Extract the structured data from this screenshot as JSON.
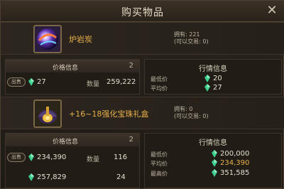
{
  "window": {
    "title": "购买物品",
    "close": "✕"
  },
  "item1": {
    "name": "炉岩炭",
    "owned": "拥有: 221",
    "tradable": "(可以交易: 0)",
    "price_panel": {
      "header": "价格信息",
      "count": "2",
      "sell_label": "出售",
      "price": "27",
      "qty_label": "数量",
      "qty": "259,222"
    },
    "market": {
      "header": "行情信息",
      "min_label": "最低价",
      "min": "20",
      "avg_label": "平均价",
      "avg": "27"
    }
  },
  "item2": {
    "name": "+16~18强化宝珠礼盒",
    "owned": "拥有: 0",
    "tradable": "(可以交易: 0)",
    "price_panel": {
      "header": "价格信息",
      "count": "2",
      "sell_label": "出售",
      "price": "234,390",
      "qty_label": "数量",
      "qty": "116",
      "price2": "257,829",
      "qty2": "24"
    },
    "market": {
      "header": "行情信息",
      "min_label": "最低价",
      "min": "200,000",
      "avg_label": "平均价",
      "avg": "234,390",
      "max_label": "最高价",
      "max": "351,585"
    }
  },
  "colors": {
    "accent": "#e8b04a",
    "gem": "#3fcf8e"
  },
  "icons": {
    "currency": "green-gem-icon",
    "close": "close-icon"
  }
}
